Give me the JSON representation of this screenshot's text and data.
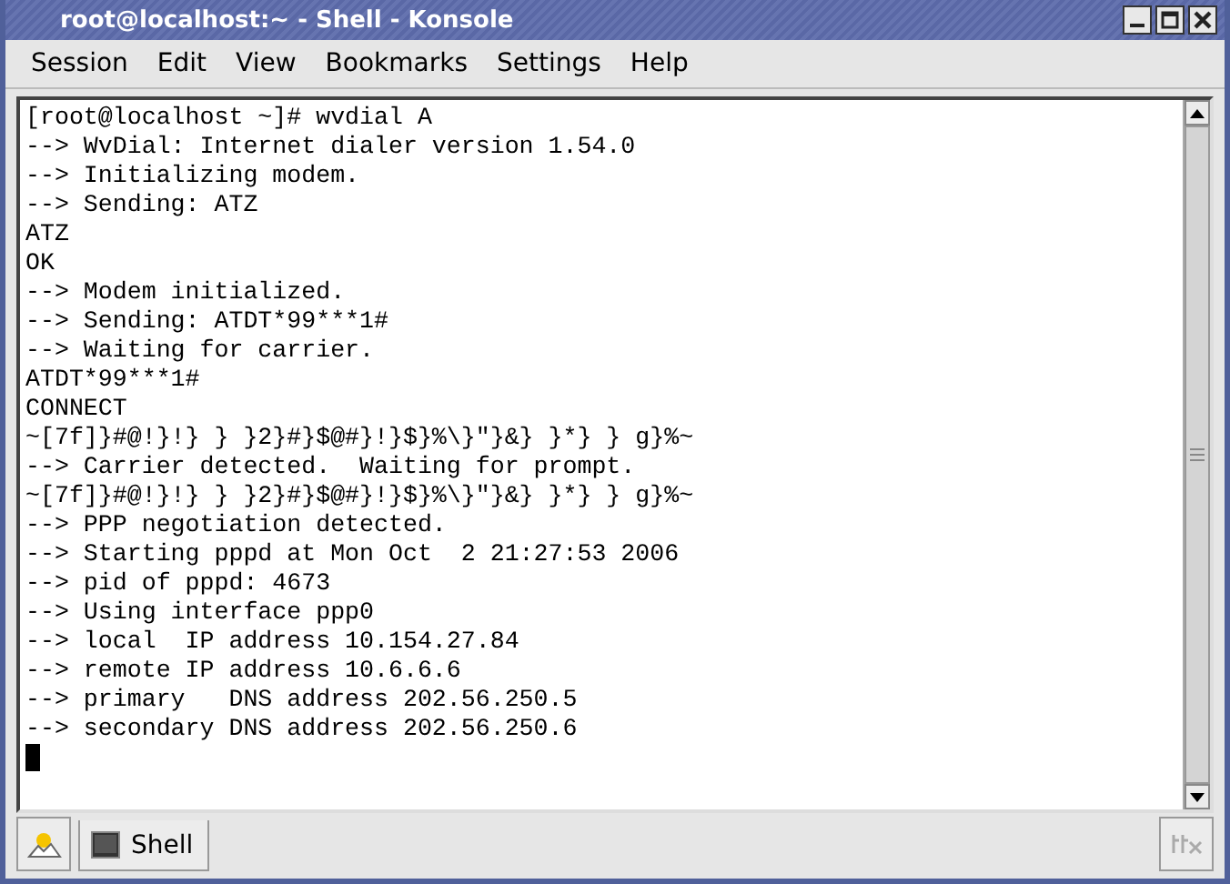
{
  "window": {
    "title": "root@localhost:~ - Shell - Konsole"
  },
  "menu": [
    "Session",
    "Edit",
    "View",
    "Bookmarks",
    "Settings",
    "Help"
  ],
  "terminal": {
    "lines": [
      "[root@localhost ~]# wvdial A",
      "--> WvDial: Internet dialer version 1.54.0",
      "--> Initializing modem.",
      "--> Sending: ATZ",
      "ATZ",
      "OK",
      "--> Modem initialized.",
      "--> Sending: ATDT*99***1#",
      "--> Waiting for carrier.",
      "ATDT*99***1#",
      "CONNECT",
      "~[7f]}#@!}!} } }2}#}$@#}!}$}%\\}\"}&} }*} } g}%~",
      "--> Carrier detected.  Waiting for prompt.",
      "~[7f]}#@!}!} } }2}#}$@#}!}$}%\\}\"}&} }*} } g}%~",
      "--> PPP negotiation detected.",
      "--> Starting pppd at Mon Oct  2 21:27:53 2006",
      "--> pid of pppd: 4673",
      "--> Using interface ppp0",
      "--> local  IP address 10.154.27.84",
      "--> remote IP address 10.6.6.6",
      "--> primary   DNS address 202.56.250.5",
      "--> secondary DNS address 202.56.250.6"
    ]
  },
  "tabs": [
    {
      "label": "Shell",
      "selected": true
    }
  ]
}
